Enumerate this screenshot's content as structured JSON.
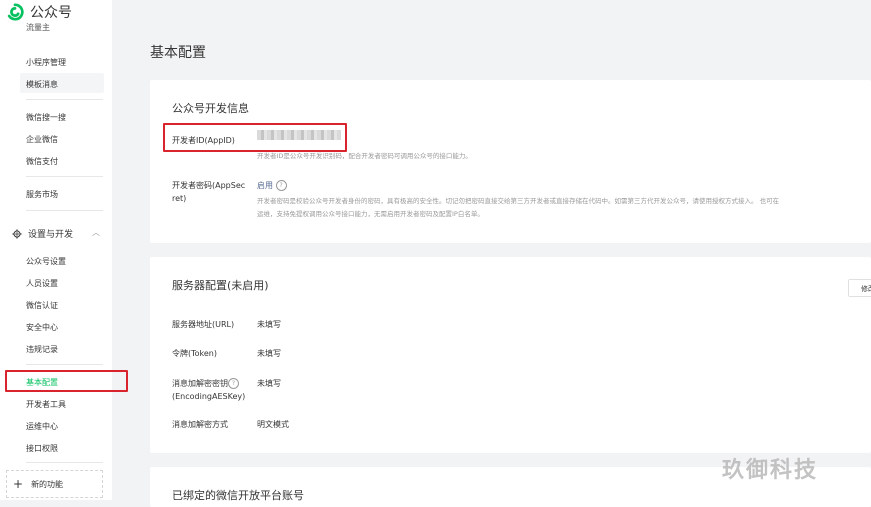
{
  "app": {
    "title": "公众号"
  },
  "sidebar": {
    "cut_item": "流量主",
    "group1": [
      "小程序管理",
      "模板消息"
    ],
    "group2": [
      "微信搜一搜",
      "企业微信",
      "微信支付"
    ],
    "group3": [
      "服务市场"
    ],
    "section": {
      "label": "设置与开发"
    },
    "settings_items": [
      "公众号设置",
      "人员设置",
      "微信认证",
      "安全中心",
      "违规记录"
    ],
    "dev_items": [
      "基本配置",
      "开发者工具",
      "运维中心",
      "接口权限"
    ],
    "new_feature": "新的功能"
  },
  "main": {
    "page_title": "基本配置",
    "dev_info": {
      "title": "公众号开发信息",
      "appid_label": "开发者ID(AppID)",
      "appid_desc": "开发者ID是公众号开发识别码，配合开发者密码可调用公众号的接口能力。",
      "secret_label_1": "开发者密码(AppSec",
      "secret_label_2": "ret)",
      "secret_value": "启用",
      "secret_desc_1": "开发者密码是校验公众号开发者身份的密码，具有极高的安全性。切记勿把密码直接交给第三方开发者或直接存储在代码中。如需第三方代开发公众号，请使用授权方式接入。 也可在",
      "secret_desc_2": "运维，支持免提权调用公众号接口能力，无需启用开发者密码及配置IP白名单。"
    },
    "server": {
      "title": "服务器配置(未启用)",
      "modify_button": "修改",
      "url_label": "服务器地址(URL)",
      "url_value": "未填写",
      "token_label": "令牌(Token)",
      "token_value": "未填写",
      "aes_label_1": "消息加解密密钥",
      "aes_label_2": "(EncodingAESKey)",
      "aes_value": "未填写",
      "mode_label": "消息加解密方式",
      "mode_value": "明文模式"
    },
    "bound": {
      "title": "已绑定的微信开放平台账号"
    }
  },
  "watermark": "玖御科技"
}
